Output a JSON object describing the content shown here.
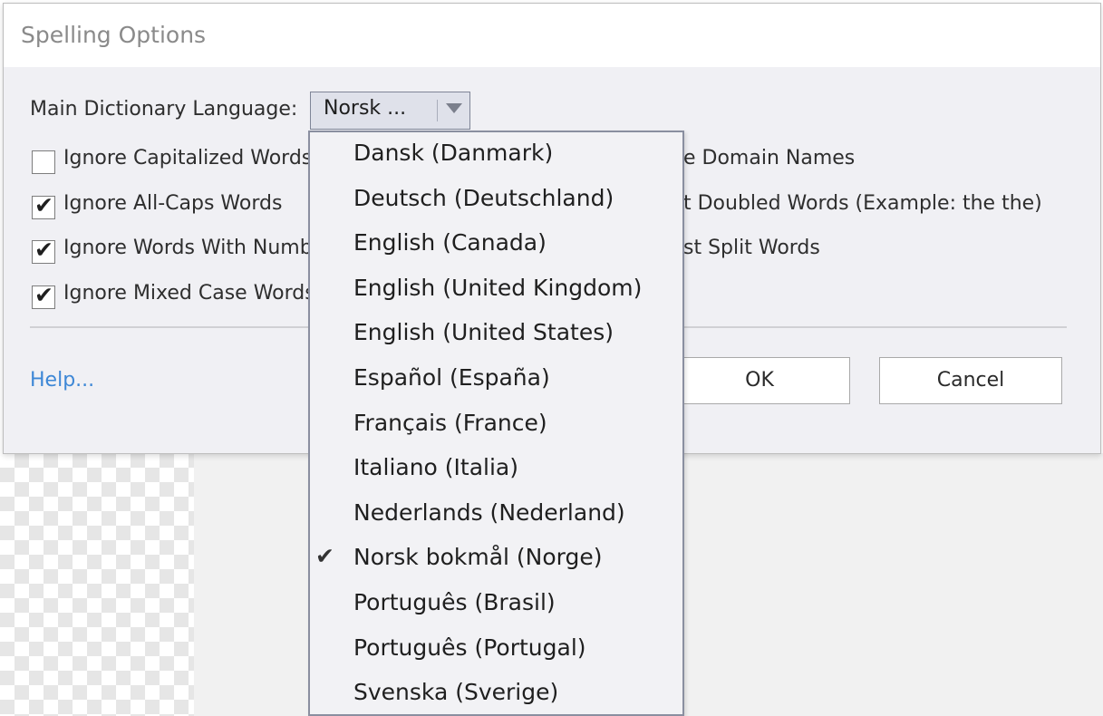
{
  "dialog": {
    "title": "Spelling Options",
    "main_dictionary_label": "Main Dictionary Language:",
    "selected_language_short": "Norsk ...",
    "options_left": [
      {
        "label": "Ignore Capitalized Words",
        "checked": false
      },
      {
        "label": "Ignore All-Caps Words",
        "checked": true
      },
      {
        "label": "Ignore Words With Numbers",
        "checked": true
      },
      {
        "label": "Ignore Mixed Case Words",
        "checked": true
      }
    ],
    "options_right_visible": [
      "e Domain Names",
      "t Doubled Words (Example: the the)",
      "st Split Words"
    ],
    "help_link": "Help...",
    "ok_label": "OK",
    "cancel_label": "Cancel"
  },
  "dropdown": {
    "items": [
      "Dansk (Danmark)",
      "Deutsch (Deutschland)",
      "English (Canada)",
      "English (United Kingdom)",
      "English (United States)",
      "Español (España)",
      "Français (France)",
      "Italiano (Italia)",
      "Nederlands (Nederland)",
      "Norsk bokmål (Norge)",
      "Português (Brasil)",
      "Português (Portugal)",
      "Svenska (Sverige)"
    ],
    "selected": "Norsk bokmål (Norge)",
    "check_glyph": "✔"
  },
  "colors": {
    "link": "#3d87d6",
    "dialog_bg": "#f0f0f4",
    "dropdown_border": "#8a8fa0"
  }
}
